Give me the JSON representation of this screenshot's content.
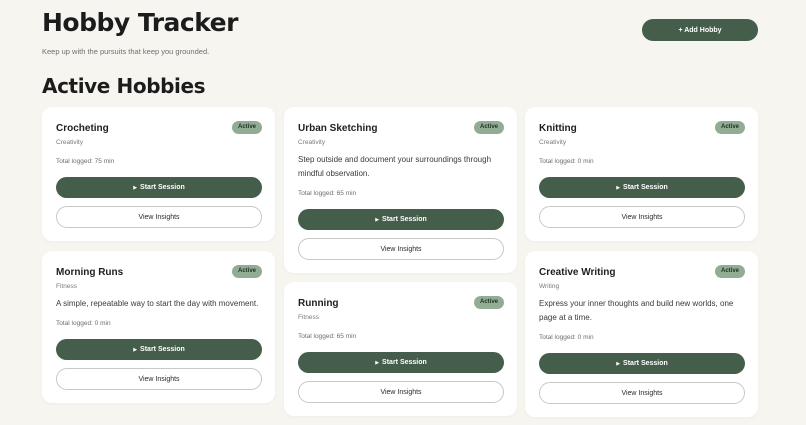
{
  "header": {
    "title": "Hobby Tracker",
    "subtitle": "Keep up with the pursuits that keep you grounded.",
    "add_button": "+ Add Hobby"
  },
  "section_title": "Active Hobbies",
  "buttons": {
    "start_icon": "play-icon",
    "start_label": "Start Session",
    "insights_label": "View Insights"
  },
  "colors": {
    "primary": "#455e4b",
    "badge": "#93ad95",
    "background": "#f7f5f0"
  },
  "hobbies": [
    {
      "name": "Crocheting",
      "status": "Active",
      "category": "Creativity",
      "description": "",
      "logged": "Total logged: 75 min"
    },
    {
      "name": "Urban Sketching",
      "status": "Active",
      "category": "Creativity",
      "description": "Step outside and document your surroundings through mindful observation.",
      "logged": "Total logged: 65 min"
    },
    {
      "name": "Knitting",
      "status": "Active",
      "category": "Creativity",
      "description": "",
      "logged": "Total logged: 0 min"
    },
    {
      "name": "Morning Runs",
      "status": "Active",
      "category": "Fitness",
      "description": "A simple, repeatable way to start the day with movement.",
      "logged": "Total logged: 0 min"
    },
    {
      "name": "Running",
      "status": "Active",
      "category": "Fitness",
      "description": "",
      "logged": "Total logged: 65 min"
    },
    {
      "name": "Creative Writing",
      "status": "Active",
      "category": "Writing",
      "description": "Express your inner thoughts and build new worlds, one page at a time.",
      "logged": "Total logged: 0 min"
    }
  ]
}
